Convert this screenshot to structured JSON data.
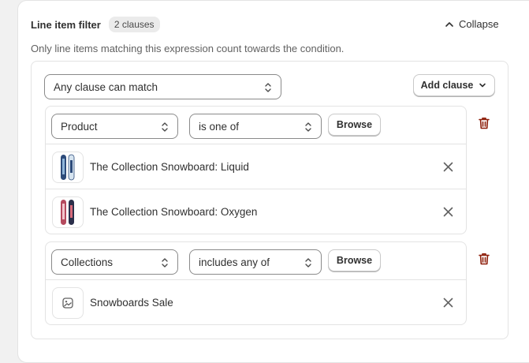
{
  "filter": {
    "title": "Line item filter",
    "clause_count": "2 clauses",
    "collapse_label": "Collapse",
    "helper_text": "Only line items matching this expression count towards the condition.",
    "match_mode": "Any clause can match",
    "add_clause_label": "Add clause"
  },
  "clauses": [
    {
      "field": "Product",
      "operator": "is one of",
      "browse_label": "Browse",
      "items": [
        {
          "label": "The Collection Snowboard: Liquid",
          "thumb": "snowboard-liquid"
        },
        {
          "label": "The Collection Snowboard: Oxygen",
          "thumb": "snowboard-oxygen"
        }
      ]
    },
    {
      "field": "Collections",
      "operator": "includes any of",
      "browse_label": "Browse",
      "items": [
        {
          "label": "Snowboards Sale",
          "thumb": "image-placeholder-icon"
        }
      ]
    }
  ],
  "colors": {
    "accent_danger": "#8e1f0b",
    "border": "#e3e3e3",
    "text": "#303030"
  }
}
